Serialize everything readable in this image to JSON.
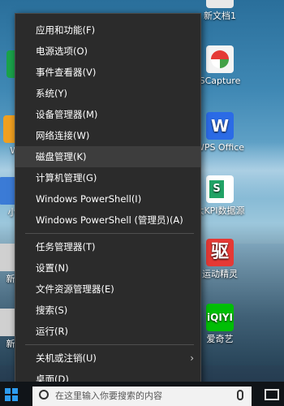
{
  "desktop": {
    "icons": [
      {
        "label": "新文档1"
      },
      {
        "label": "SCapture"
      },
      {
        "label": "WPS Office"
      },
      {
        "label": "大KPI数据源"
      },
      {
        "label": "运动精灵"
      },
      {
        "label": "爱奇艺"
      },
      {
        "label": "新"
      },
      {
        "label": "新"
      },
      {
        "label": "小"
      },
      {
        "label": "We"
      },
      {
        "label": "C"
      }
    ]
  },
  "menu": {
    "items": [
      {
        "label": "应用和功能(F)"
      },
      {
        "label": "电源选项(O)"
      },
      {
        "label": "事件查看器(V)"
      },
      {
        "label": "系统(Y)"
      },
      {
        "label": "设备管理器(M)"
      },
      {
        "label": "网络连接(W)"
      },
      {
        "label": "磁盘管理(K)"
      },
      {
        "label": "计算机管理(G)"
      },
      {
        "label": "Windows PowerShell(I)"
      },
      {
        "label": "Windows PowerShell (管理员)(A)"
      },
      {
        "label": "任务管理器(T)"
      },
      {
        "label": "设置(N)"
      },
      {
        "label": "文件资源管理器(E)"
      },
      {
        "label": "搜索(S)"
      },
      {
        "label": "运行(R)"
      },
      {
        "label": "关机或注销(U)"
      },
      {
        "label": "桌面(D)"
      }
    ],
    "submenu_arrow": "›"
  },
  "taskbar": {
    "search_placeholder": "在这里输入你要搜索的内容"
  },
  "colors": {
    "menu_bg": "#2b2b2b",
    "hover_bg": "#3d3d3d",
    "accent": "#2d9cf0"
  }
}
